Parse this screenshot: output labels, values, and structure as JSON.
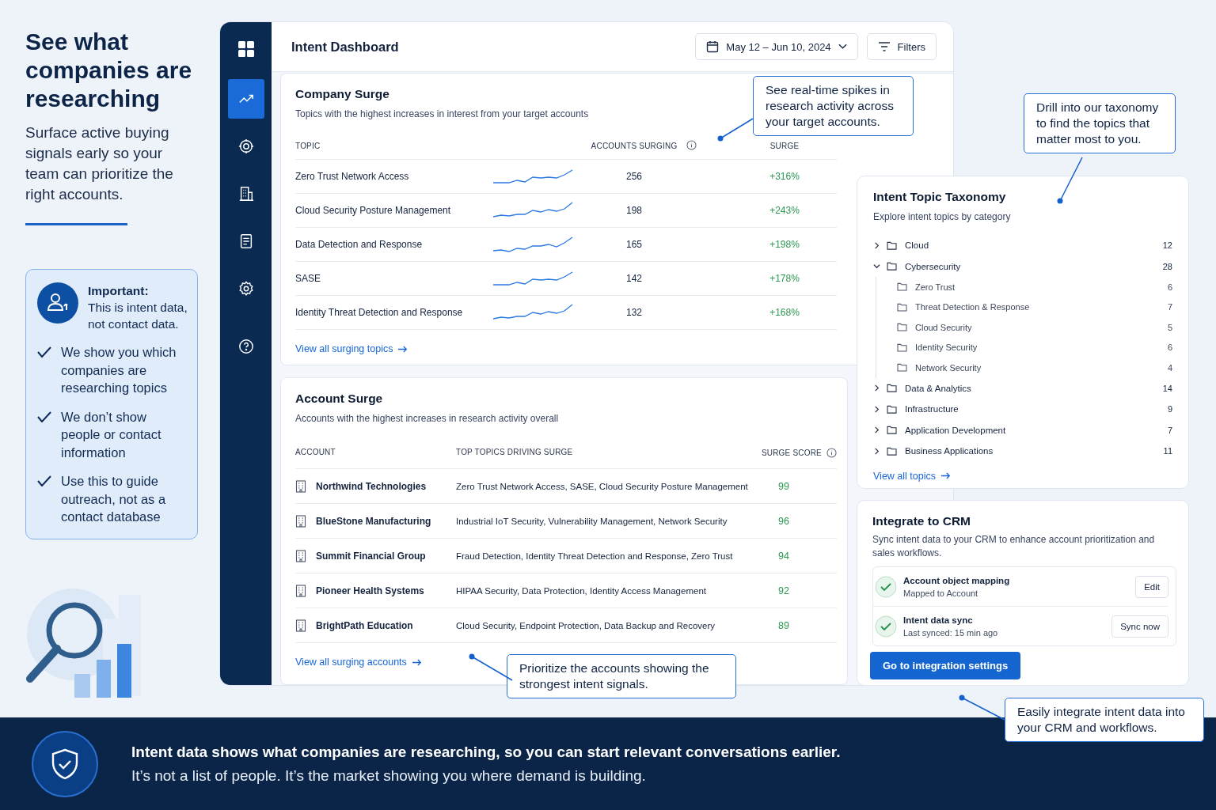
{
  "intro": {
    "headline": "See what companies are researching",
    "text": "Surface active buying signals early so your team can prioritize the right accounts."
  },
  "notice": {
    "title": "Important:",
    "text": "This is intent data, not contact data.",
    "points": [
      {
        "text": "We show you which companies are researching topics",
        "checked": true
      },
      {
        "text": "We don’t show people or contact information",
        "checked": true
      },
      {
        "text": "Use this to guide outreach, not as a contact database",
        "checked": true
      }
    ]
  },
  "sidebar": {
    "items": [
      {
        "selected": true
      },
      {
        "selected": false
      },
      {
        "selected": false
      },
      {
        "selected": false
      },
      {
        "selected": false
      },
      {
        "selected": false
      }
    ]
  },
  "header": {
    "title": "Intent Dashboard",
    "date_range": "May 12 – Jun 10, 2024",
    "filters": "Filters"
  },
  "company_surge": {
    "title": "Company Surge",
    "subtitle": "Topics with the highest increases in interest from your target accounts",
    "columns": [
      "TOPIC",
      "ACCOUNTS SURGING",
      "SURGE"
    ],
    "rows": [
      {
        "topic": "Zero Trust Network Access",
        "accounts": "256",
        "surge": "+316%"
      },
      {
        "topic": "Cloud Security Posture Management",
        "accounts": "198",
        "surge": "+243%"
      },
      {
        "topic": "Data Detection and Response",
        "accounts": "165",
        "surge": "+198%"
      },
      {
        "topic": "SASE",
        "accounts": "142",
        "surge": "+178%"
      },
      {
        "topic": "Identity Threat Detection and Response",
        "accounts": "132",
        "surge": "+168%"
      }
    ],
    "link": "View all surging topics"
  },
  "account_surge": {
    "title": "Account Surge",
    "subtitle": "Accounts with the highest increases in research activity overall",
    "columns": [
      "ACCOUNT",
      "TOP TOPICS DRIVING SURGE",
      "SURGE SCORE"
    ],
    "rows": [
      {
        "account": "Northwind Technologies",
        "topics": "Zero Trust Network Access, SASE, Cloud Security Posture Management",
        "score": "99"
      },
      {
        "account": "BlueStone Manufacturing",
        "topics": "Industrial IoT Security, Vulnerability Management, Network Security",
        "score": "96"
      },
      {
        "account": "Summit Financial Group",
        "topics": "Fraud Detection, Identity Threat Detection and Response, Zero Trust",
        "score": "94"
      },
      {
        "account": "Pioneer Health Systems",
        "topics": "HIPAA Security, Data Protection, Identity Access Management",
        "score": "92"
      },
      {
        "account": "BrightPath Education",
        "topics": "Cloud Security, Endpoint Protection, Data Backup and Recovery",
        "score": "89"
      }
    ],
    "link": "View all surging accounts"
  },
  "taxonomy": {
    "title": "Intent Topic Taxonomy",
    "subtitle": "Explore intent topics by category",
    "items": [
      {
        "label": "Cloud",
        "count": "12",
        "expanded": false
      },
      {
        "label": "Cybersecurity",
        "count": "28",
        "expanded": true,
        "children": [
          {
            "label": "Zero Trust",
            "count": "6"
          },
          {
            "label": "Threat Detection & Response",
            "count": "7"
          },
          {
            "label": "Cloud Security",
            "count": "5"
          },
          {
            "label": "Identity Security",
            "count": "6"
          },
          {
            "label": "Network Security",
            "count": "4"
          }
        ]
      },
      {
        "label": "Data & Analytics",
        "count": "14",
        "expanded": false
      },
      {
        "label": "Infrastructure",
        "count": "9",
        "expanded": false
      },
      {
        "label": "Application Development",
        "count": "7",
        "expanded": false
      },
      {
        "label": "Business Applications",
        "count": "11",
        "expanded": false
      }
    ],
    "link": "View all topics"
  },
  "crm": {
    "title": "Integrate to CRM",
    "subtitle": "Sync intent data to your CRM to enhance account prioritization and sales workflows.",
    "items": [
      {
        "title": "Account object mapping",
        "detail": "Mapped to Account",
        "done": true,
        "action": "Edit"
      },
      {
        "title": "Intent data sync",
        "detail": "Last synced: 15 min ago",
        "done": true,
        "action": "Sync now"
      }
    ],
    "button": "Go to integration settings"
  },
  "callouts": [
    {
      "text": "See real-time spikes in research activity across your target accounts."
    },
    {
      "text": "Drill into our taxonomy to find the topics that matter most to you."
    },
    {
      "text": "Prioritize the accounts showing the strongest intent signals."
    },
    {
      "text": "Easily integrate intent data into your CRM and workflows."
    }
  ],
  "banner": {
    "headline": "Intent data shows what companies are researching, so you can start relevant conversations earlier.",
    "text": "It’s not a list of people. It’s the market showing you where demand is building."
  }
}
